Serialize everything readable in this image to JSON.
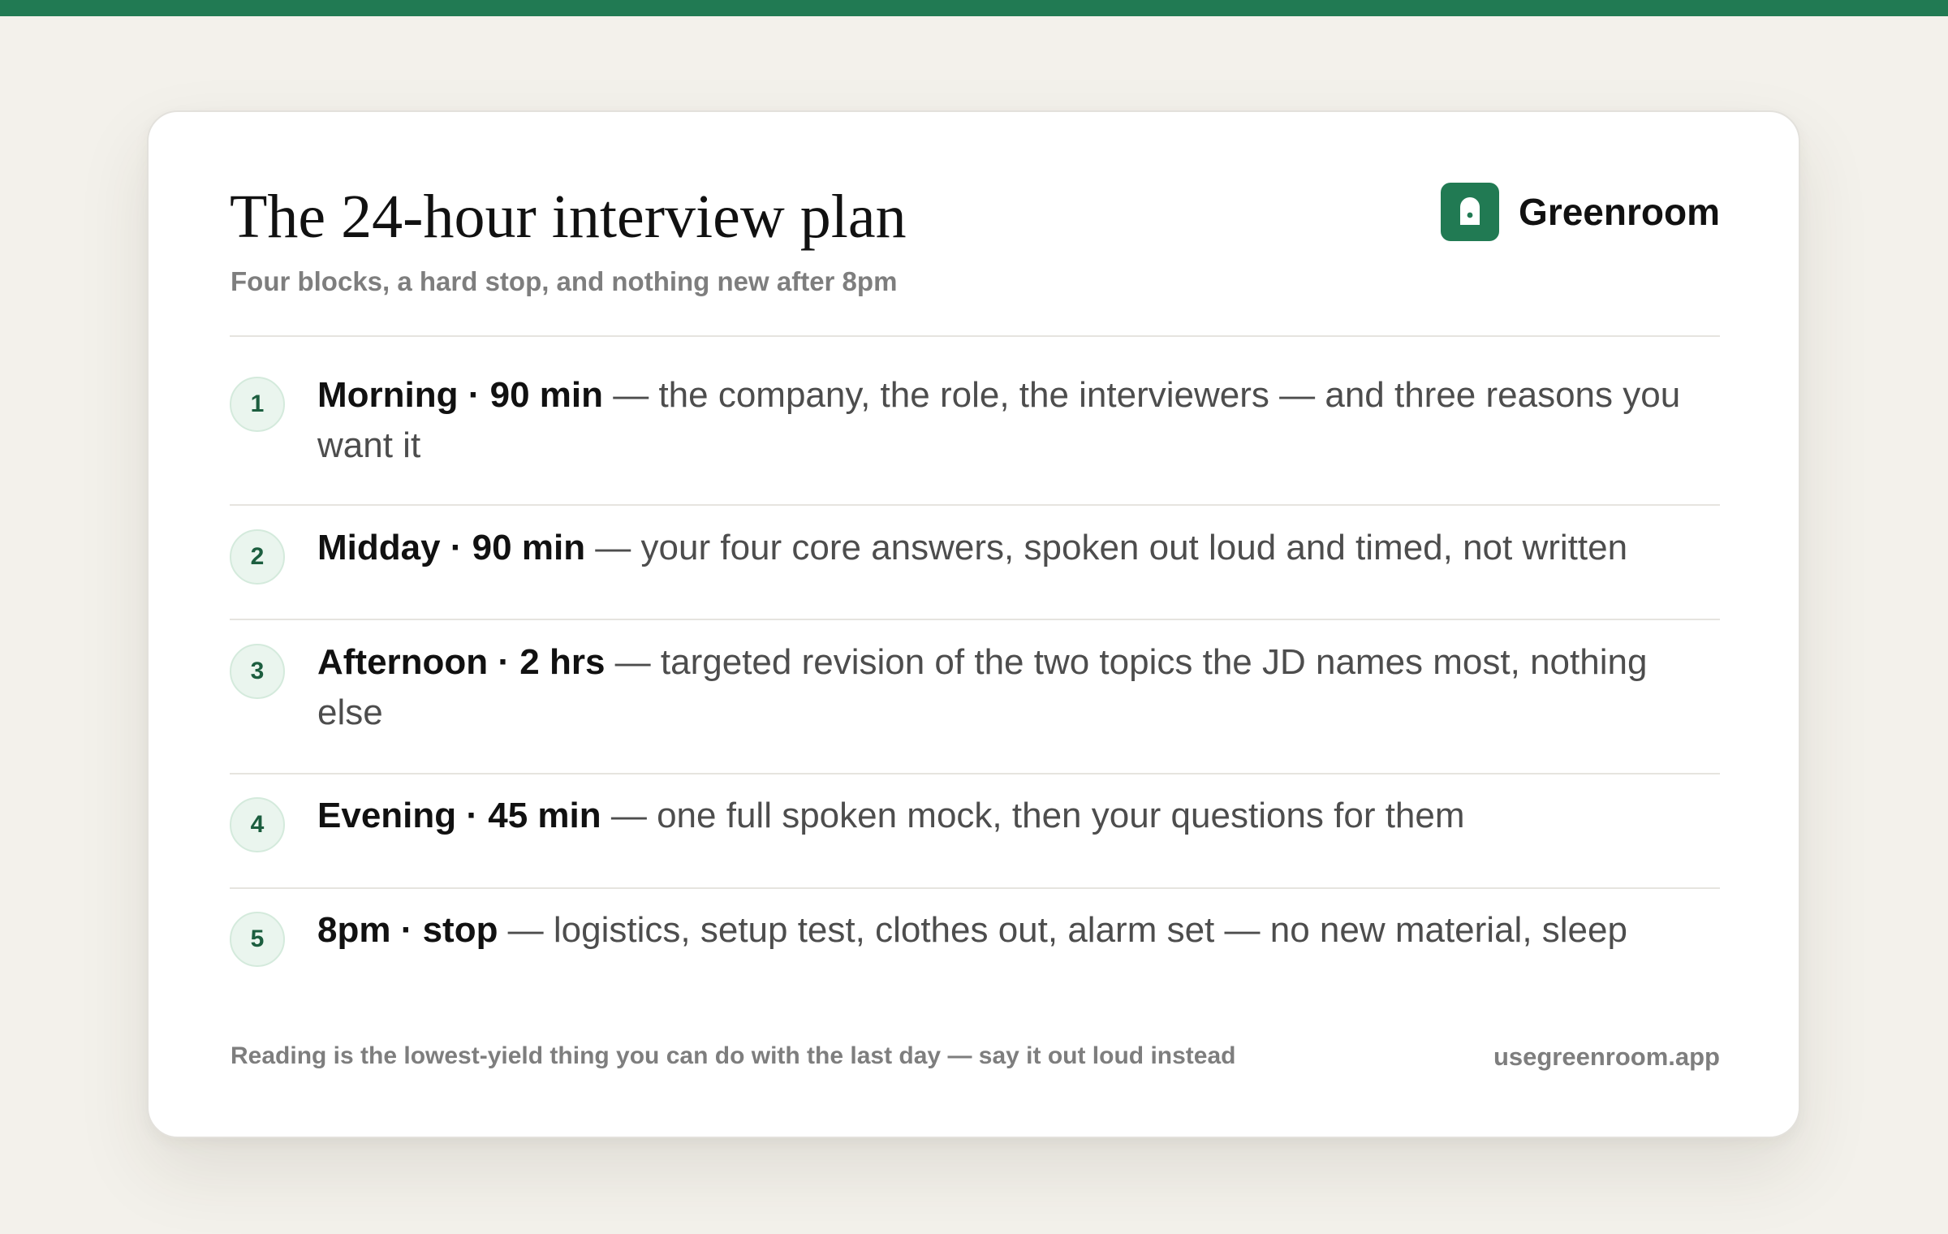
{
  "accent_color": "#217a53",
  "header": {
    "title": "The 24-hour interview plan",
    "subtitle": "Four blocks, a hard stop, and nothing new after 8pm"
  },
  "brand": {
    "name": "Greenroom",
    "logo_icon": "lock-icon"
  },
  "items": [
    {
      "number": "1",
      "head": "Morning · 90 min",
      "text": " — the company, the role, the interviewers — and three reasons you want it"
    },
    {
      "number": "2",
      "head": "Midday · 90 min",
      "text": " — your four core answers, spoken out loud and timed, not written"
    },
    {
      "number": "3",
      "head": "Afternoon · 2 hrs",
      "text": " — targeted revision of the two topics the JD names most, nothing else"
    },
    {
      "number": "4",
      "head": "Evening · 45 min",
      "text": " — one full spoken mock, then your questions for them"
    },
    {
      "number": "5",
      "head": "8pm · stop",
      "text": " — logistics, setup test, clothes out, alarm set — no new material, sleep"
    }
  ],
  "footer": {
    "note": "Reading is the lowest-yield thing you can do with the last day — say it out loud instead",
    "url": "usegreenroom.app"
  }
}
